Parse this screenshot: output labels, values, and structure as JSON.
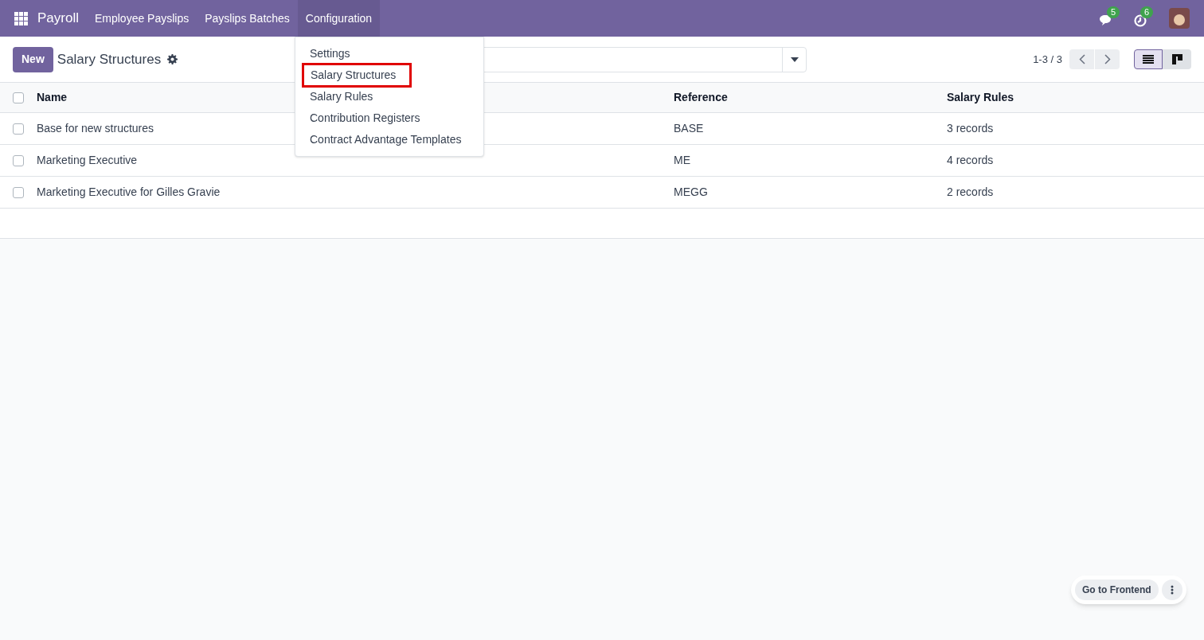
{
  "navbar": {
    "app": "Payroll",
    "menus": [
      {
        "label": "Employee Payslips",
        "open": false
      },
      {
        "label": "Payslips Batches",
        "open": false
      },
      {
        "label": "Configuration",
        "open": true
      }
    ],
    "messages_count": "5",
    "activities_count": "6"
  },
  "dropdown": {
    "items": [
      {
        "label": "Settings",
        "selected": false
      },
      {
        "label": "Salary Structures",
        "selected": true
      },
      {
        "label": "Salary Rules",
        "selected": false
      },
      {
        "label": "Contribution Registers",
        "selected": false
      },
      {
        "label": "Contract Advantage Templates",
        "selected": false
      }
    ]
  },
  "control_panel": {
    "new_button": "New",
    "title": "Salary Structures",
    "pager": "1-3 / 3",
    "views": [
      {
        "kind": "list",
        "selected": true
      },
      {
        "kind": "kanban",
        "selected": false
      }
    ]
  },
  "table": {
    "all_checked": false,
    "columns": [
      "Name",
      "Reference",
      "Salary Rules"
    ],
    "rows": [
      {
        "checked": false,
        "cells": [
          "Base for new structures",
          "BASE",
          "3 records"
        ]
      },
      {
        "checked": false,
        "cells": [
          "Marketing Executive",
          "ME",
          "4 records"
        ]
      },
      {
        "checked": false,
        "cells": [
          "Marketing Executive for Gilles Gravie",
          "MEGG",
          "2 records"
        ]
      }
    ]
  },
  "frontend_button": "Go to Frontend"
}
